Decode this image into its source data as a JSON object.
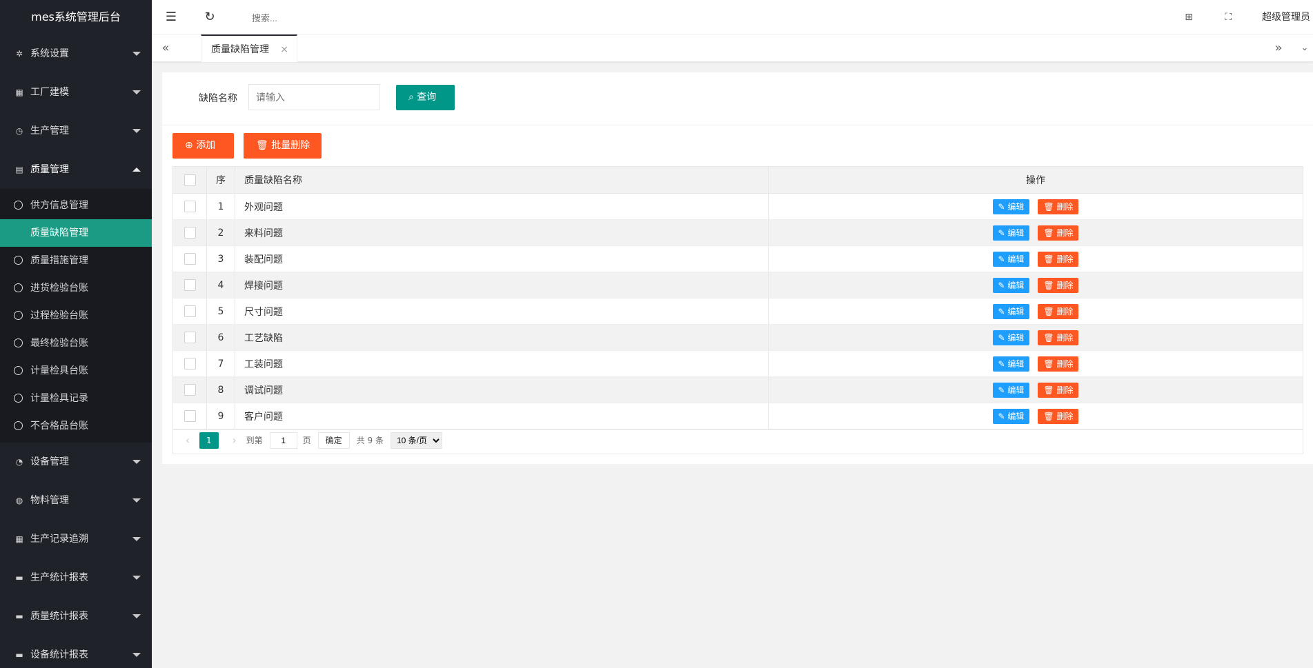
{
  "app": {
    "title": "mes系统管理后台"
  },
  "sidebar": {
    "groups_top": [
      {
        "label": "系统设置",
        "icon": "gear-icon",
        "glyph": "✲"
      },
      {
        "label": "工厂建模",
        "icon": "apps-icon",
        "glyph": "▦"
      },
      {
        "label": "生产管理",
        "icon": "clock-icon",
        "glyph": "◷"
      },
      {
        "label": "质量管理",
        "icon": "document-icon",
        "glyph": "▤"
      }
    ],
    "sub_items": [
      {
        "label": "供方信息管理"
      },
      {
        "label": "质量缺陷管理"
      },
      {
        "label": "质量措施管理"
      },
      {
        "label": "进货检验台账"
      },
      {
        "label": "过程检验台账"
      },
      {
        "label": "最终检验台账"
      },
      {
        "label": "计量检具台账"
      },
      {
        "label": "计量检具记录"
      },
      {
        "label": "不合格品台账"
      }
    ],
    "groups_bottom": [
      {
        "label": "设备管理",
        "icon": "dashboard-icon",
        "glyph": "◔"
      },
      {
        "label": "物料管理",
        "icon": "globe-icon",
        "glyph": "◍"
      },
      {
        "label": "生产记录追溯",
        "icon": "grid-icon",
        "glyph": "▦"
      },
      {
        "label": "生产统计报表",
        "icon": "monitor-icon",
        "glyph": "▬"
      },
      {
        "label": "质量统计报表",
        "icon": "monitor-icon",
        "glyph": "▬"
      },
      {
        "label": "设备统计报表",
        "icon": "monitor-icon",
        "glyph": "▬"
      }
    ]
  },
  "header": {
    "search_placeholder": "搜索...",
    "user": "超级管理员"
  },
  "tabs": {
    "active_tab": "质量缺陷管理"
  },
  "search": {
    "label": "缺陷名称",
    "placeholder": "请输入",
    "query_button": "查询"
  },
  "toolbar": {
    "add_button": "添加",
    "batch_delete_button": "批量删除"
  },
  "table": {
    "headers": {
      "index": "序",
      "name": "质量缺陷名称",
      "actions": "操作"
    },
    "edit_label": "编辑",
    "delete_label": "删除",
    "rows": [
      {
        "index": "1",
        "name": "外观问题"
      },
      {
        "index": "2",
        "name": "来料问题"
      },
      {
        "index": "3",
        "name": "装配问题"
      },
      {
        "index": "4",
        "name": "焊接问题"
      },
      {
        "index": "5",
        "name": "尺寸问题"
      },
      {
        "index": "6",
        "name": "工艺缺陷"
      },
      {
        "index": "7",
        "name": "工装问题"
      },
      {
        "index": "8",
        "name": "调试问题"
      },
      {
        "index": "9",
        "name": "客户问题"
      }
    ]
  },
  "pagination": {
    "current_page": "1",
    "goto_label": "到第",
    "goto_value": "1",
    "page_unit": "页",
    "confirm": "确定",
    "total": "共 9 条",
    "page_size": "10 条/页"
  },
  "colors": {
    "sidebar_bg": "#20222a",
    "active_item": "#1b9b83",
    "primary": "#009688",
    "danger": "#ff5722",
    "edit": "#1e9fff"
  }
}
